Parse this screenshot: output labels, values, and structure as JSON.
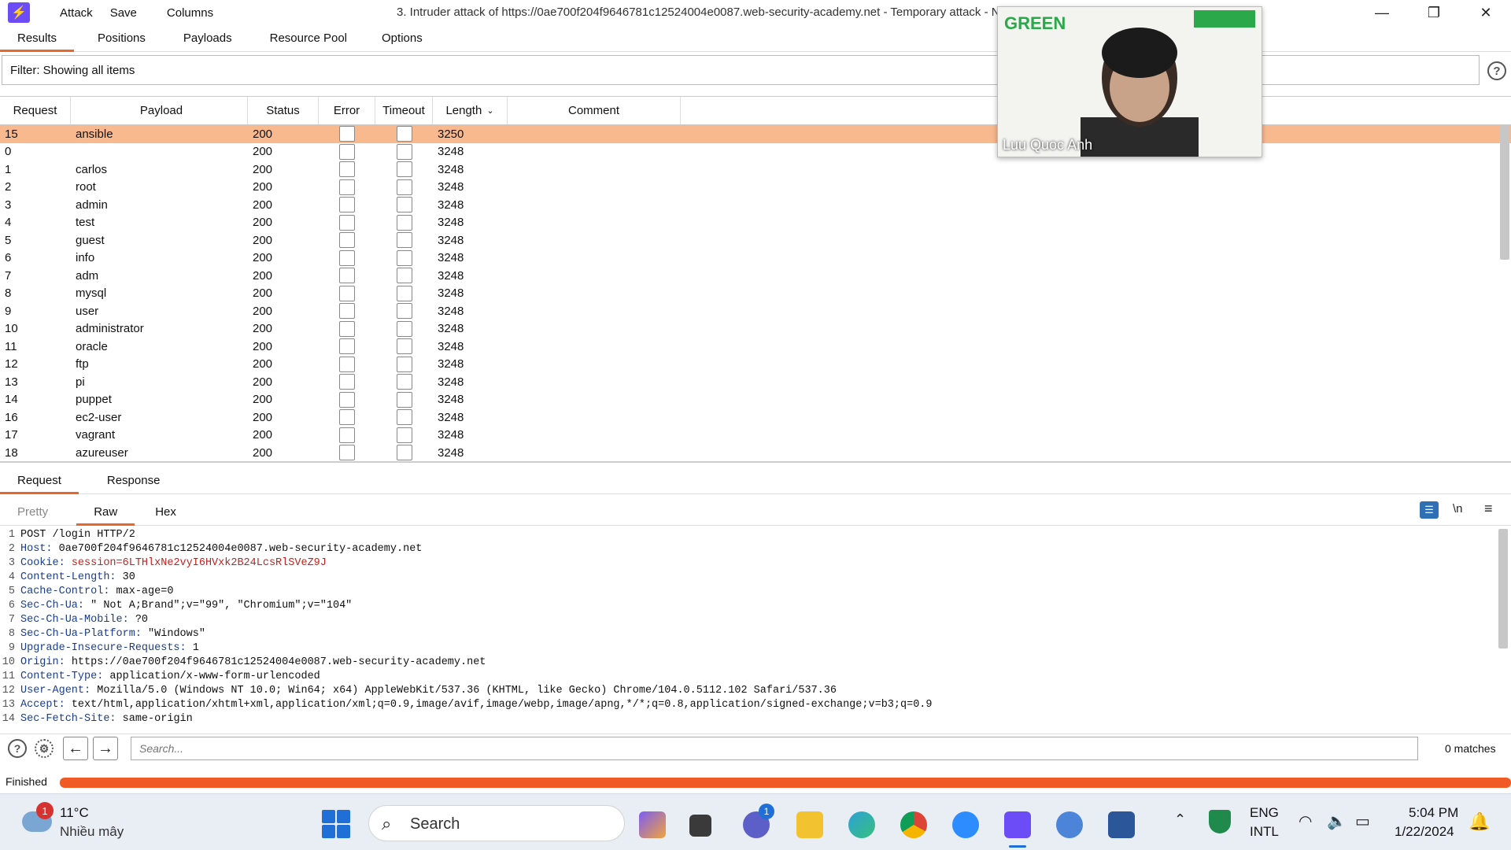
{
  "window": {
    "title": "3. Intruder attack of https://0ae700f204f9646781c12524004e0087.web-security-academy.net - Temporary attack - N",
    "menu": [
      "Attack",
      "Save",
      "Columns"
    ]
  },
  "top_tabs": [
    "Results",
    "Positions",
    "Payloads",
    "Resource Pool",
    "Options"
  ],
  "filter": {
    "label": "Filter: Showing all items"
  },
  "table": {
    "headers": [
      "Request",
      "Payload",
      "Status",
      "Error",
      "Timeout",
      "Length",
      "Comment"
    ],
    "rows": [
      {
        "request": "15",
        "payload": "ansible",
        "status": "200",
        "length": "3250"
      },
      {
        "request": "0",
        "payload": "",
        "status": "200",
        "length": "3248"
      },
      {
        "request": "1",
        "payload": "carlos",
        "status": "200",
        "length": "3248"
      },
      {
        "request": "2",
        "payload": "root",
        "status": "200",
        "length": "3248"
      },
      {
        "request": "3",
        "payload": "admin",
        "status": "200",
        "length": "3248"
      },
      {
        "request": "4",
        "payload": "test",
        "status": "200",
        "length": "3248"
      },
      {
        "request": "5",
        "payload": "guest",
        "status": "200",
        "length": "3248"
      },
      {
        "request": "6",
        "payload": "info",
        "status": "200",
        "length": "3248"
      },
      {
        "request": "7",
        "payload": "adm",
        "status": "200",
        "length": "3248"
      },
      {
        "request": "8",
        "payload": "mysql",
        "status": "200",
        "length": "3248"
      },
      {
        "request": "9",
        "payload": "user",
        "status": "200",
        "length": "3248"
      },
      {
        "request": "10",
        "payload": "administrator",
        "status": "200",
        "length": "3248"
      },
      {
        "request": "11",
        "payload": "oracle",
        "status": "200",
        "length": "3248"
      },
      {
        "request": "12",
        "payload": "ftp",
        "status": "200",
        "length": "3248"
      },
      {
        "request": "13",
        "payload": "pi",
        "status": "200",
        "length": "3248"
      },
      {
        "request": "14",
        "payload": "puppet",
        "status": "200",
        "length": "3248"
      },
      {
        "request": "16",
        "payload": "ec2-user",
        "status": "200",
        "length": "3248"
      },
      {
        "request": "17",
        "payload": "vagrant",
        "status": "200",
        "length": "3248"
      },
      {
        "request": "18",
        "payload": "azureuser",
        "status": "200",
        "length": "3248"
      }
    ]
  },
  "rr_tabs": [
    "Request",
    "Response"
  ],
  "view_tabs": [
    "Pretty",
    "Raw",
    "Hex"
  ],
  "view_buttons": {
    "newline": "\\n"
  },
  "editor": {
    "lines": [
      {
        "n": "1",
        "name": "",
        "value": "POST /login HTTP/2"
      },
      {
        "n": "2",
        "name": "Host:",
        "value": " 0ae700f204f9646781c12524004e0087.web-security-academy.net"
      },
      {
        "n": "3",
        "name": "Cookie:",
        "value": " session=6LTHlxNe2vyI6HVxk2B24LcsRlSVeZ9J",
        "cookie": true
      },
      {
        "n": "4",
        "name": "Content-Length:",
        "value": " 30"
      },
      {
        "n": "5",
        "name": "Cache-Control:",
        "value": " max-age=0"
      },
      {
        "n": "6",
        "name": "Sec-Ch-Ua:",
        "value": " \" Not A;Brand\";v=\"99\", \"Chromium\";v=\"104\""
      },
      {
        "n": "7",
        "name": "Sec-Ch-Ua-Mobile:",
        "value": " ?0"
      },
      {
        "n": "8",
        "name": "Sec-Ch-Ua-Platform:",
        "value": " \"Windows\""
      },
      {
        "n": "9",
        "name": "Upgrade-Insecure-Requests:",
        "value": " 1"
      },
      {
        "n": "10",
        "name": "Origin:",
        "value": " https://0ae700f204f9646781c12524004e0087.web-security-academy.net"
      },
      {
        "n": "11",
        "name": "Content-Type:",
        "value": " application/x-www-form-urlencoded"
      },
      {
        "n": "12",
        "name": "User-Agent:",
        "value": " Mozilla/5.0 (Windows NT 10.0; Win64; x64) AppleWebKit/537.36 (KHTML, like Gecko) Chrome/104.0.5112.102 Safari/537.36"
      },
      {
        "n": "13",
        "name": "Accept:",
        "value": " text/html,application/xhtml+xml,application/xml;q=0.9,image/avif,image/webp,image/apng,*/*;q=0.8,application/signed-exchange;v=b3;q=0.9"
      },
      {
        "n": "14",
        "name": "Sec-Fetch-Site:",
        "value": " same-origin"
      }
    ]
  },
  "search": {
    "placeholder": "Search...",
    "matches": "0 matches"
  },
  "status": {
    "text": "Finished",
    "progress": 1.0
  },
  "webcam": {
    "name": "Luu Quoc Anh",
    "logo_text": "GREEN"
  },
  "taskbar": {
    "weather_temp": "11°C",
    "weather_desc": "Nhiều mây",
    "weather_badge": "1",
    "search_label": "Search",
    "lang_1": "ENG",
    "lang_2": "INTL",
    "time": "5:04 PM",
    "date": "1/22/2024",
    "teams_badge": "1"
  },
  "colors": {
    "accent": "#e8672b",
    "selected_row": "#f9b98f",
    "progress": "#f05a24"
  }
}
